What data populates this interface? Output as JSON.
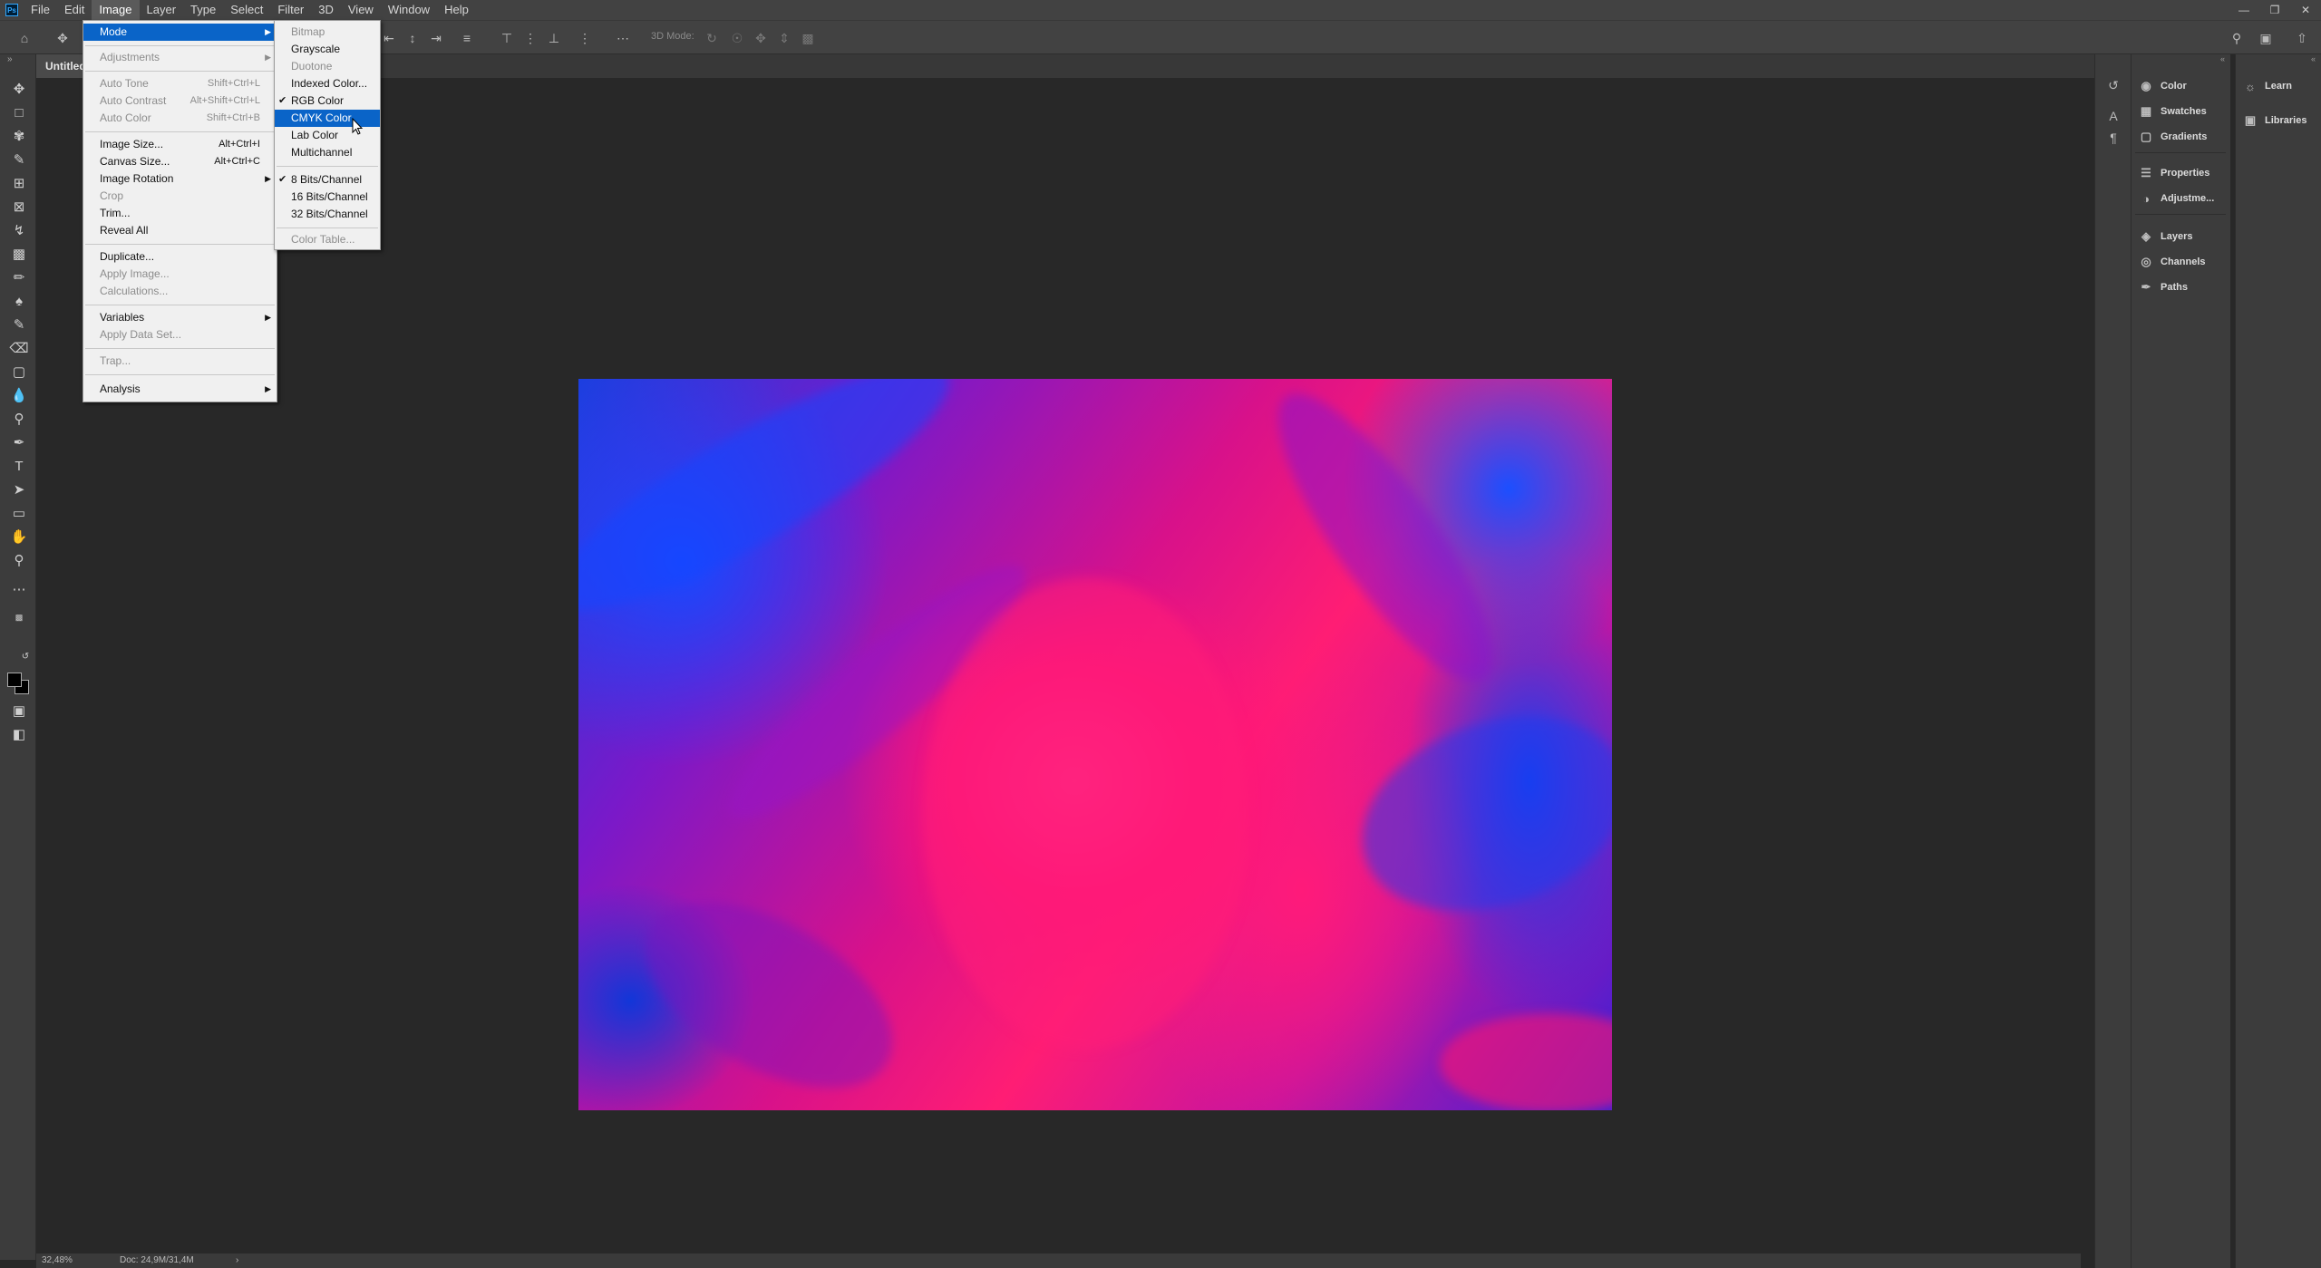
{
  "menubar": {
    "logo": "Ps",
    "items": [
      "File",
      "Edit",
      "Image",
      "Layer",
      "Type",
      "Select",
      "Filter",
      "3D",
      "View",
      "Window",
      "Help"
    ],
    "active_index": 2
  },
  "window_controls": [
    "minimize",
    "restore",
    "close"
  ],
  "optionsbar": {
    "label_3d_mode": "3D Mode:"
  },
  "document": {
    "tab_title": "Untitled"
  },
  "statusbar": {
    "zoom": "32,48%",
    "doc_size": "Doc: 24,9M/31,4M",
    "arrow": "›"
  },
  "image_menu": {
    "items": [
      {
        "label": "Mode",
        "shortcut": "",
        "submenu": true,
        "disabled": false,
        "highlight": true
      },
      {
        "label": "Adjustments",
        "shortcut": "",
        "submenu": true,
        "disabled": true
      },
      {
        "label": "Auto Tone",
        "shortcut": "Shift+Ctrl+L",
        "disabled": true
      },
      {
        "label": "Auto Contrast",
        "shortcut": "Alt+Shift+Ctrl+L",
        "disabled": true
      },
      {
        "label": "Auto Color",
        "shortcut": "Shift+Ctrl+B",
        "disabled": true
      },
      {
        "label": "Image Size...",
        "shortcut": "Alt+Ctrl+I",
        "disabled": false
      },
      {
        "label": "Canvas Size...",
        "shortcut": "Alt+Ctrl+C",
        "disabled": false
      },
      {
        "label": "Image Rotation",
        "shortcut": "",
        "submenu": true,
        "disabled": false
      },
      {
        "label": "Crop",
        "shortcut": "",
        "disabled": true
      },
      {
        "label": "Trim...",
        "shortcut": "",
        "disabled": false
      },
      {
        "label": "Reveal All",
        "shortcut": "",
        "disabled": false
      },
      {
        "label": "Duplicate...",
        "shortcut": "",
        "disabled": false
      },
      {
        "label": "Apply Image...",
        "shortcut": "",
        "disabled": true
      },
      {
        "label": "Calculations...",
        "shortcut": "",
        "disabled": true
      },
      {
        "label": "Variables",
        "shortcut": "",
        "submenu": true,
        "disabled": false
      },
      {
        "label": "Apply Data Set...",
        "shortcut": "",
        "disabled": true
      },
      {
        "label": "Trap...",
        "shortcut": "",
        "disabled": true
      },
      {
        "label": "Analysis",
        "shortcut": "",
        "submenu": true,
        "disabled": false
      }
    ]
  },
  "mode_menu": {
    "items": [
      {
        "label": "Bitmap",
        "disabled": true
      },
      {
        "label": "Grayscale",
        "disabled": false
      },
      {
        "label": "Duotone",
        "disabled": true
      },
      {
        "label": "Indexed Color...",
        "disabled": false
      },
      {
        "label": "RGB Color",
        "disabled": false,
        "checked": true
      },
      {
        "label": "CMYK Color",
        "disabled": false,
        "highlight": true
      },
      {
        "label": "Lab Color",
        "disabled": false
      },
      {
        "label": "Multichannel",
        "disabled": false
      },
      {
        "label": "8 Bits/Channel",
        "disabled": false,
        "checked": true
      },
      {
        "label": "16 Bits/Channel",
        "disabled": false
      },
      {
        "label": "32 Bits/Channel",
        "disabled": false
      },
      {
        "label": "Color Table...",
        "disabled": true
      }
    ]
  },
  "panels": {
    "group1": [
      "Color",
      "Swatches",
      "Gradients"
    ],
    "group2": [
      "Properties",
      "Adjustme..."
    ],
    "group3": [
      "Layers",
      "Channels",
      "Paths"
    ],
    "group4": [
      "Learn",
      "Libraries"
    ]
  },
  "colors": {
    "menu_highlight": "#0a64c8",
    "foreground_swatch": "#000000",
    "background_swatch": "#000000"
  }
}
